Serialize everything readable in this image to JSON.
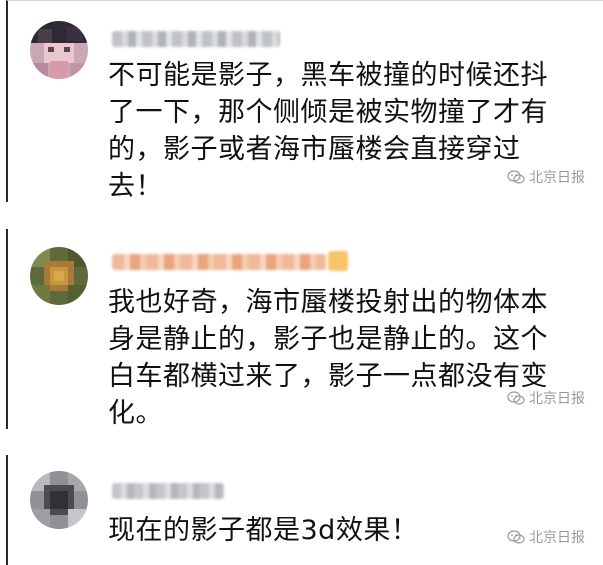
{
  "comments": [
    {
      "username": "",
      "text": "不可能是影子，黑车被撞的时候还抖\n了一下，那个侧倾是被实物撞了才有\n的，影子或者海市蜃楼会直接穿过\n去！",
      "watermark": "北京日报"
    },
    {
      "username": "",
      "text": "我也好奇，海市蜃楼投射出的物体本\n身是静止的，影子也是静止的。这个\n白车都横过来了，影子一点都没有变\n化。",
      "watermark": "北京日报"
    },
    {
      "username": "",
      "text": "现在的影子都是3d效果！",
      "watermark": "北京日报"
    }
  ],
  "icons": {
    "avatar": "avatar-icon",
    "watermark": "wechat-logo-icon"
  },
  "colors": {
    "text": "#111111",
    "watermark": "#9a9a9a",
    "divider": "#2a2a2a"
  }
}
